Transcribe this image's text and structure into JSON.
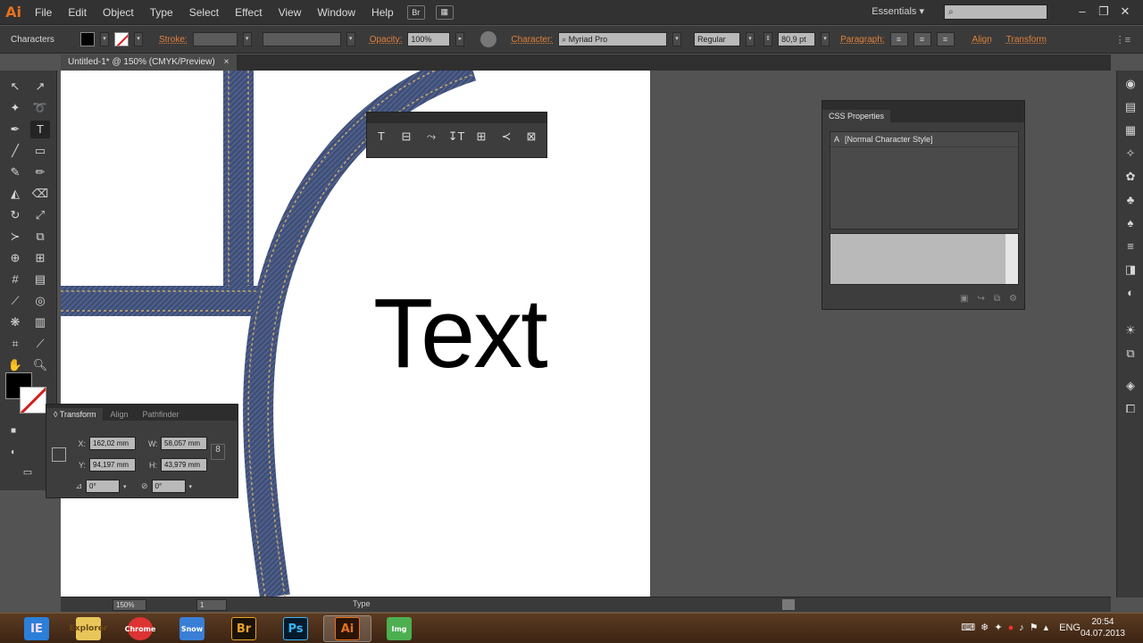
{
  "app": {
    "logo": "Ai"
  },
  "menu": {
    "items": [
      "File",
      "Edit",
      "Object",
      "Type",
      "Select",
      "Effect",
      "View",
      "Window",
      "Help"
    ]
  },
  "workspace": {
    "label": "Essentials",
    "search_placeholder": ""
  },
  "control_bar": {
    "panel_name": "Characters",
    "stroke_label": "Stroke:",
    "opacity_label": "Opacity:",
    "opacity_value": "100%",
    "character_label": "Character:",
    "font_value": "Myriad Pro",
    "style_value": "Regular",
    "size_value": "80,9 pt",
    "paragraph_label": "Paragraph:",
    "align_label": "Align",
    "transform_label": "Transform"
  },
  "document": {
    "tab_title": "Untitled-1* @ 150% (CMYK/Preview)",
    "close": "×"
  },
  "artwork": {
    "text": "Text"
  },
  "float_toolbar": {
    "buttons": [
      "T",
      "⊟",
      "⤳",
      "↧T",
      "⊞",
      "≺",
      "⊠"
    ]
  },
  "transform_panel": {
    "tabs": [
      "◊ Transform",
      "Align",
      "Pathfinder"
    ],
    "x_label": "X:",
    "x_value": "162,02 mm",
    "y_label": "Y:",
    "y_value": "94,197 mm",
    "w_label": "W:",
    "w_value": "58,057 mm",
    "h_label": "H:",
    "h_value": "43,979 mm",
    "rotate_value": "0°",
    "shear_value": "0°"
  },
  "css_panel": {
    "title": "CSS Properties",
    "item": "[Normal Character Style]"
  },
  "status_bar": {
    "zoom": "150%",
    "page": "1",
    "status": "Type"
  },
  "taskbar": {
    "apps": [
      "IE",
      "Explorer",
      "Chrome",
      "Snow",
      "Br",
      "Ps",
      "Ai",
      "Img"
    ],
    "lang": "ENG",
    "time": "20:54",
    "date": "04.07.2013"
  },
  "colors": {
    "ai_orange": "#e8711d",
    "denim": "#3f4f78",
    "stitch": "#c9a86a"
  }
}
